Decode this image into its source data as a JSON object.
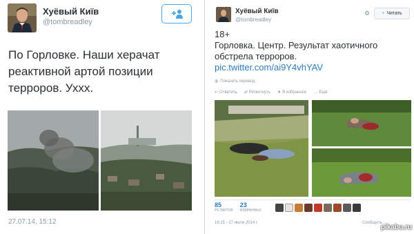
{
  "left_tweet": {
    "author_name": "Хуёвый Київ",
    "author_handle": "@tombreadley",
    "text": "По Горловке. Наши херачат реактивной артой позиции терроров. Уххх.",
    "date": "27.07.14, 15:12"
  },
  "right_tweet": {
    "author_name": "Хуёвый Київ",
    "author_handle": "@tombreadley",
    "follow_label": "Читать",
    "text_line1": "18+",
    "text_body": "Горловка. Центр. Результат хаотичного обстрела терроров.",
    "link": "pic.twitter.com/ai9Y4vhYAV",
    "translate_label": "Показать перевод",
    "actions": [
      {
        "icon": "reply-icon",
        "label": "Ответить"
      },
      {
        "icon": "retweet-icon",
        "label": "Ретвитнуть"
      },
      {
        "icon": "star-icon",
        "label": "В избранное"
      },
      {
        "icon": "more-icon",
        "label": "Ещё"
      }
    ],
    "retweets_count": "85",
    "retweets_label": "ретвитов",
    "favorites_count": "23",
    "favorites_label": "избранных",
    "footer_date": "16:15 - 27 июля 2014 г.",
    "footer_more": "Сообщить…"
  },
  "watermark": "pikabu.ru",
  "colors": {
    "link": "#2b7bb9",
    "muted": "#8899a6",
    "text": "#292f33",
    "follow_border": "#4aa6e3"
  }
}
